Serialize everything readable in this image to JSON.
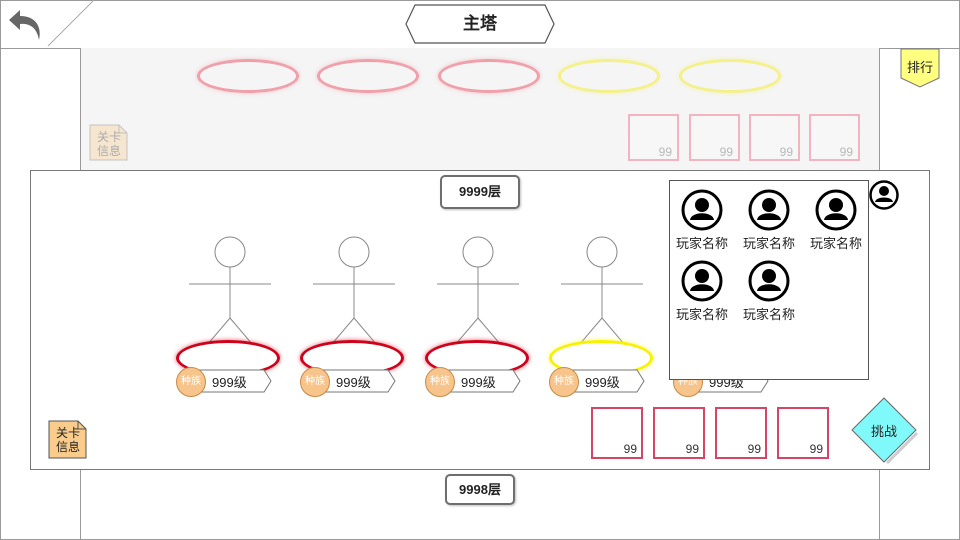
{
  "header": {
    "title": "主塔",
    "back_icon": "back-arrow-icon"
  },
  "rank_button": {
    "label": "排行",
    "color": "#ffff80"
  },
  "upper_floor": {
    "ring_colors": [
      "pink",
      "pink",
      "pink",
      "yellow",
      "yellow"
    ],
    "info_label_line1": "关卡",
    "info_label_line2": "信息",
    "rewards": [
      {
        "count": "99"
      },
      {
        "count": "99"
      },
      {
        "count": "99"
      },
      {
        "count": "99"
      }
    ]
  },
  "current_floor": {
    "floor_label": "9999层",
    "info_label_line1": "关卡",
    "info_label_line2": "信息",
    "info_color": "#f9cc8b",
    "units": [
      {
        "race": "种族",
        "level": "999级",
        "ring": "red"
      },
      {
        "race": "种族",
        "level": "999级",
        "ring": "red"
      },
      {
        "race": "种族",
        "level": "999级",
        "ring": "red"
      },
      {
        "race": "种族",
        "level": "999级",
        "ring": "yellow"
      },
      {
        "race": "种族",
        "level": "999级",
        "ring": "hidden"
      }
    ],
    "rewards": [
      {
        "count": "99"
      },
      {
        "count": "99"
      },
      {
        "count": "99"
      },
      {
        "count": "99"
      }
    ],
    "challenge_label": "挑战",
    "challenge_color": "#7ff9f9"
  },
  "player_panel": {
    "players": [
      {
        "name": "玩家名称"
      },
      {
        "name": "玩家名称"
      },
      {
        "name": "玩家名称"
      },
      {
        "name": "玩家名称"
      },
      {
        "name": "玩家名称"
      }
    ]
  },
  "lower_floor": {
    "floor_label": "9998层"
  },
  "colors": {
    "ring_red": "#d0021b",
    "ring_yellow": "#f8f200",
    "reward_border": "#d64565"
  }
}
